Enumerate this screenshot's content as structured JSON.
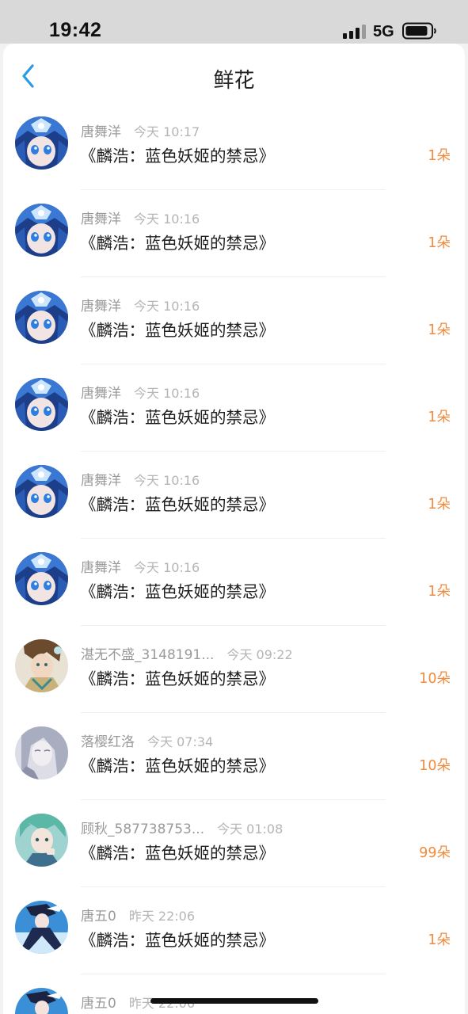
{
  "status_bar": {
    "time": "19:42",
    "network": "5G"
  },
  "header": {
    "title": "鲜花"
  },
  "colors": {
    "accent_orange": "#f08a3c",
    "back_arrow_blue": "#2a9be0"
  },
  "items": [
    {
      "user": "唐舞洋",
      "time": "今天 10:17",
      "book": "《麟浩：蓝色妖姬的禁忌》",
      "count": "1朵",
      "avatar": "blue-haired-anime-avatar"
    },
    {
      "user": "唐舞洋",
      "time": "今天 10:16",
      "book": "《麟浩：蓝色妖姬的禁忌》",
      "count": "1朵",
      "avatar": "blue-haired-anime-avatar"
    },
    {
      "user": "唐舞洋",
      "time": "今天 10:16",
      "book": "《麟浩：蓝色妖姬的禁忌》",
      "count": "1朵",
      "avatar": "blue-haired-anime-avatar"
    },
    {
      "user": "唐舞洋",
      "time": "今天 10:16",
      "book": "《麟浩：蓝色妖姬的禁忌》",
      "count": "1朵",
      "avatar": "blue-haired-anime-avatar"
    },
    {
      "user": "唐舞洋",
      "time": "今天 10:16",
      "book": "《麟浩：蓝色妖姬的禁忌》",
      "count": "1朵",
      "avatar": "blue-haired-anime-avatar"
    },
    {
      "user": "唐舞洋",
      "time": "今天 10:16",
      "book": "《麟浩：蓝色妖姬的禁忌》",
      "count": "1朵",
      "avatar": "blue-haired-anime-avatar"
    },
    {
      "user": "湛无不盛_3148191...",
      "time": "今天 09:22",
      "book": "《麟浩：蓝色妖姬的禁忌》",
      "count": "10朵",
      "avatar": "brown-haired-anime-avatar"
    },
    {
      "user": "落樱红洛",
      "time": "今天 07:34",
      "book": "《麟浩：蓝色妖姬的禁忌》",
      "count": "10朵",
      "avatar": "silver-haired-anime-avatar"
    },
    {
      "user": "顾秋_587738753...",
      "time": "今天 01:08",
      "book": "《麟浩：蓝色妖姬的禁忌》",
      "count": "99朵",
      "avatar": "green-haired-anime-avatar"
    },
    {
      "user": "唐五0",
      "time": "昨天 22:06",
      "book": "《麟浩：蓝色妖姬的禁忌》",
      "count": "1朵",
      "avatar": "dark-haired-anime-avatar"
    },
    {
      "user": "唐五0",
      "time": "昨天 22:06",
      "book": "",
      "count": "",
      "avatar": "dark-haired-anime-avatar"
    }
  ]
}
